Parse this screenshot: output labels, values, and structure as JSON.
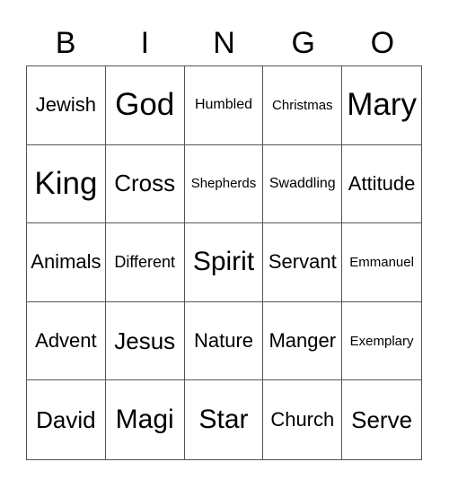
{
  "card": {
    "header": [
      "B",
      "I",
      "N",
      "G",
      "O"
    ],
    "rows": [
      [
        "Jewish",
        "God",
        "Humbled",
        "Christmas",
        "Mary"
      ],
      [
        "King",
        "Cross",
        "Shepherds",
        "Swaddling",
        "Attitude"
      ],
      [
        "Animals",
        "Different",
        "Spirit",
        "Servant",
        "Emmanuel"
      ],
      [
        "Advent",
        "Jesus",
        "Nature",
        "Manger",
        "Exemplary"
      ],
      [
        "David",
        "Magi",
        "Star",
        "Church",
        "Serve"
      ]
    ]
  }
}
